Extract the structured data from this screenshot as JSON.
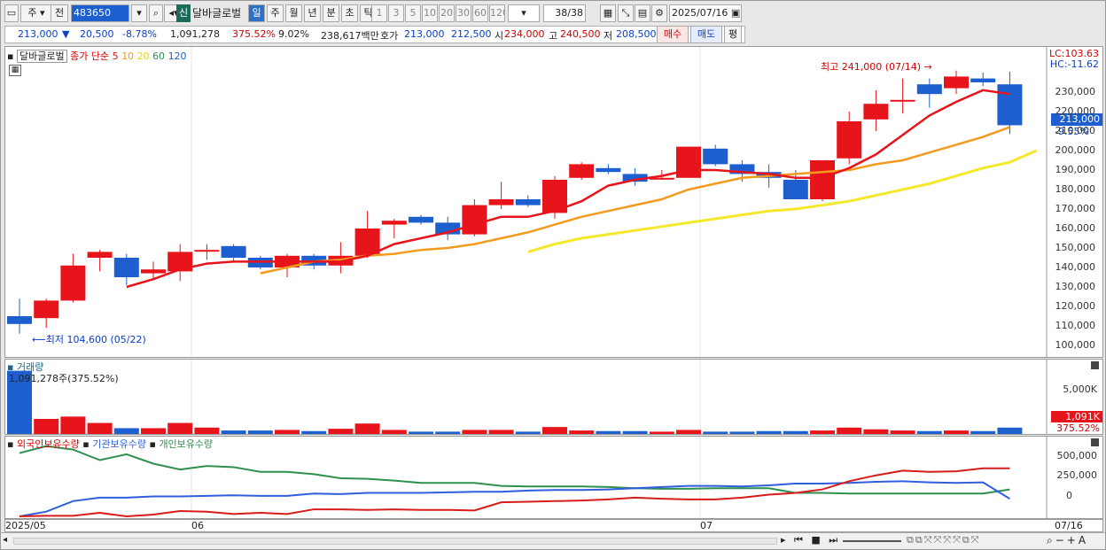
{
  "toolbar": {
    "menu_icon": "window-menu-icon",
    "period_label": "주",
    "prev_label": "전",
    "stock_code": "483650",
    "sound_icon": "speaker-icon",
    "new_badge": "신",
    "stock_name": "달바글로벌",
    "timeframes": [
      "일",
      "주",
      "월",
      "년",
      "분",
      "초",
      "틱"
    ],
    "active_timeframe": "일",
    "intervals": [
      "1",
      "3",
      "5",
      "10",
      "20",
      "30",
      "60",
      "120"
    ],
    "count": "38/38",
    "date": "2025/07/16"
  },
  "quote": {
    "price": "213,000",
    "change_arrow": "▼",
    "change": "20,500",
    "change_pct": "-8.78%",
    "volume": "1,091,278",
    "volume_pct": "375.52%",
    "turnover_pct": "9.02%",
    "amount": "238,617백만",
    "bid_label": "호가",
    "bid": "213,000",
    "ask": "212,500",
    "open_label": "시",
    "open": "234,000",
    "high_label": "고",
    "high": "240,500",
    "low_label": "저",
    "low": "208,500",
    "buy_btn": "매수",
    "sell_btn": "매도",
    "avg_btn": "평"
  },
  "price_panel": {
    "title": "달바글로벌",
    "ma_label": "종가 단순",
    "ma_periods": [
      "5",
      "10",
      "20",
      "60",
      "120"
    ],
    "lc": "LC:103.63",
    "hc": "HC:-11.62",
    "current_tag": "213,000",
    "current_pct": "-9.55%",
    "high_note": "최고 241,000 (07/14)",
    "low_note": "최저 104,600 (05/22)",
    "yticks": [
      "230,000",
      "220,000",
      "210,000",
      "200,000",
      "190,000",
      "180,000",
      "170,000",
      "160,000",
      "150,000",
      "140,000",
      "130,000",
      "120,000",
      "110,000",
      "100,000"
    ]
  },
  "volume_panel": {
    "title": "거래량",
    "note": "1,091,278주(375.52%)",
    "ytick": "5,000K",
    "tag": "1,091K",
    "tag_pct": "375.52%"
  },
  "holding_panel": {
    "legend": [
      "외국인보유수량",
      "기관보유수량",
      "개인보유수량"
    ],
    "yticks": [
      "500,000",
      "250,000",
      "0"
    ]
  },
  "xaxis": {
    "labels": [
      "2025/05",
      "06",
      "07"
    ],
    "last": "07/16"
  },
  "chart_data": {
    "type": "candlestick",
    "candles": [
      [
        115000,
        124000,
        106000,
        111000
      ],
      [
        114000,
        124000,
        109000,
        123000
      ],
      [
        123000,
        147000,
        122000,
        141000
      ],
      [
        145000,
        149000,
        138000,
        148000
      ],
      [
        145000,
        147000,
        131000,
        135000
      ],
      [
        137000,
        143000,
        134000,
        139000
      ],
      [
        138000,
        152000,
        133000,
        148000
      ],
      [
        149000,
        152000,
        144000,
        149000
      ],
      [
        151000,
        152000,
        143000,
        145000
      ],
      [
        145000,
        146000,
        139000,
        140000
      ],
      [
        140000,
        147000,
        135000,
        146000
      ],
      [
        146000,
        147000,
        139000,
        141000
      ],
      [
        141000,
        153000,
        137000,
        146000
      ],
      [
        146000,
        169000,
        145000,
        160000
      ],
      [
        162000,
        165000,
        155000,
        164000
      ],
      [
        166000,
        167000,
        162000,
        163000
      ],
      [
        163000,
        166000,
        154000,
        157000
      ],
      [
        157000,
        175000,
        156000,
        172000
      ],
      [
        172000,
        184000,
        170000,
        175000
      ],
      [
        175000,
        177000,
        171000,
        172000
      ],
      [
        168000,
        187000,
        165000,
        185000
      ],
      [
        186000,
        194000,
        185000,
        193000
      ],
      [
        191000,
        193000,
        188000,
        189000
      ],
      [
        188000,
        191000,
        182000,
        184000
      ],
      [
        186000,
        190000,
        185000,
        186000
      ],
      [
        186000,
        202000,
        186000,
        202000
      ],
      [
        201000,
        203000,
        192000,
        193000
      ],
      [
        193000,
        195000,
        184000,
        188000
      ],
      [
        189000,
        193000,
        181000,
        186000
      ],
      [
        185000,
        190000,
        175000,
        175000
      ],
      [
        175000,
        195000,
        174000,
        195000
      ],
      [
        196000,
        220000,
        193000,
        215000
      ],
      [
        216000,
        231000,
        210000,
        224000
      ],
      [
        226000,
        237000,
        219000,
        226000
      ],
      [
        234000,
        237000,
        222000,
        229000
      ],
      [
        232000,
        241000,
        229000,
        238000
      ],
      [
        237000,
        240000,
        233000,
        235000
      ],
      [
        234000,
        240500,
        208500,
        213000
      ]
    ],
    "ma5": [
      null,
      null,
      null,
      null,
      130000,
      134000,
      139000,
      142000,
      143000,
      143000,
      143000,
      143000,
      143000,
      146000,
      152000,
      155000,
      158000,
      162000,
      166000,
      166000,
      169000,
      174000,
      182000,
      185000,
      187000,
      190000,
      190000,
      189000,
      188000,
      186000,
      186000,
      191000,
      198000,
      208000,
      218000,
      225000,
      231000,
      229000
    ],
    "ma10": [
      null,
      null,
      null,
      null,
      null,
      null,
      null,
      null,
      null,
      137000,
      140000,
      143000,
      144000,
      146000,
      147000,
      149000,
      150000,
      152000,
      155000,
      158000,
      162000,
      166000,
      169000,
      172000,
      175000,
      180000,
      183000,
      186000,
      187000,
      188000,
      189000,
      190000,
      193000,
      195000,
      199000,
      203000,
      207000,
      212000
    ],
    "ma20": [
      null,
      null,
      null,
      null,
      null,
      null,
      null,
      null,
      null,
      null,
      null,
      null,
      null,
      null,
      null,
      null,
      null,
      null,
      null,
      148000,
      152000,
      155000,
      157000,
      159000,
      161000,
      163000,
      165000,
      167000,
      169000,
      170000,
      172000,
      174000,
      177000,
      180000,
      183000,
      187000,
      191000,
      194000,
      200000
    ]
  },
  "volume_data": [
    1091,
    260,
    300,
    190,
    100,
    100,
    190,
    110,
    60,
    60,
    70,
    50,
    90,
    180,
    70,
    40,
    40,
    70,
    70,
    40,
    120,
    60,
    50,
    50,
    40,
    70,
    40,
    40,
    50,
    50,
    60,
    110,
    80,
    60,
    50,
    60,
    50,
    110
  ],
  "holdings": {
    "foreign": [
      0,
      5,
      5,
      30,
      0,
      15,
      45,
      40,
      20,
      30,
      20,
      60,
      60,
      55,
      60,
      55,
      55,
      50,
      120,
      125,
      130,
      135,
      145,
      160,
      150,
      145,
      145,
      160,
      185,
      200,
      230,
      300,
      350,
      390,
      380,
      385,
      410,
      410
    ],
    "institution": [
      0,
      40,
      130,
      160,
      160,
      170,
      170,
      175,
      180,
      175,
      175,
      195,
      190,
      200,
      200,
      200,
      205,
      210,
      210,
      220,
      225,
      225,
      230,
      240,
      250,
      260,
      260,
      255,
      265,
      280,
      280,
      285,
      295,
      300,
      290,
      285,
      290,
      150
    ],
    "individual": [
      540,
      600,
      570,
      480,
      530,
      450,
      400,
      430,
      420,
      380,
      380,
      360,
      325,
      320,
      305,
      285,
      285,
      285,
      260,
      255,
      255,
      255,
      250,
      240,
      235,
      235,
      240,
      240,
      240,
      200,
      200,
      195,
      195,
      195,
      195,
      195,
      195,
      230
    ]
  },
  "colors": {
    "up": "#e8141b",
    "down": "#1e5fd0",
    "ma5": "#e8141b",
    "ma10": "#f29b1e",
    "ma20": "#f5e82a",
    "foreign": "#d81c1c",
    "institution": "#2f5fdc",
    "individual": "#2e8f4f"
  }
}
